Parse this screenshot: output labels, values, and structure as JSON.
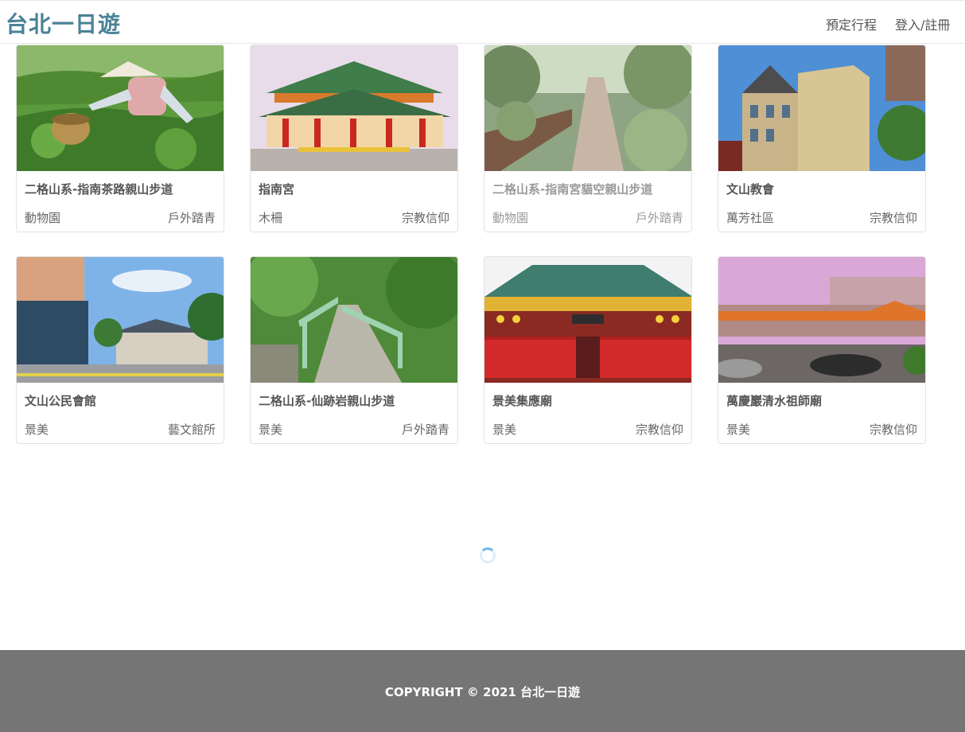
{
  "header": {
    "brand": "台北一日遊",
    "nav": [
      "預定行程",
      "登入/註冊"
    ]
  },
  "attractions": [
    {
      "name": "二格山系-指南茶路親山步道",
      "district": "動物園",
      "category": "戶外踏青",
      "image": "tea-picker-photo"
    },
    {
      "name": "指南宮",
      "district": "木柵",
      "category": "宗教信仰",
      "image": "temple-photo"
    },
    {
      "name": "二格山系-指南宮貓空親山步道",
      "district": "動物園",
      "category": "戶外踏青",
      "image": "trail-photo"
    },
    {
      "name": "文山教會",
      "district": "萬芳社區",
      "category": "宗教信仰",
      "image": "church-photo"
    },
    {
      "name": "文山公民會館",
      "district": "景美",
      "category": "藝文館所",
      "image": "civic-hall-photo"
    },
    {
      "name": "二格山系-仙跡岩親山步道",
      "district": "景美",
      "category": "戶外踏青",
      "image": "stairs-trail-photo"
    },
    {
      "name": "景美集應廟",
      "district": "景美",
      "category": "宗教信仰",
      "image": "red-temple-photo"
    },
    {
      "name": "萬慶巖清水祖師廟",
      "district": "景美",
      "category": "宗教信仰",
      "image": "street-temple-photo"
    }
  ],
  "loading": {
    "icon": "loading-spinner-icon"
  },
  "footer": {
    "copyright": "COPYRIGHT © 2021 台北一日遊"
  },
  "colors": {
    "brand": "#4a8396",
    "footer_bg": "#757575",
    "card_border": "#e2e2e2"
  }
}
